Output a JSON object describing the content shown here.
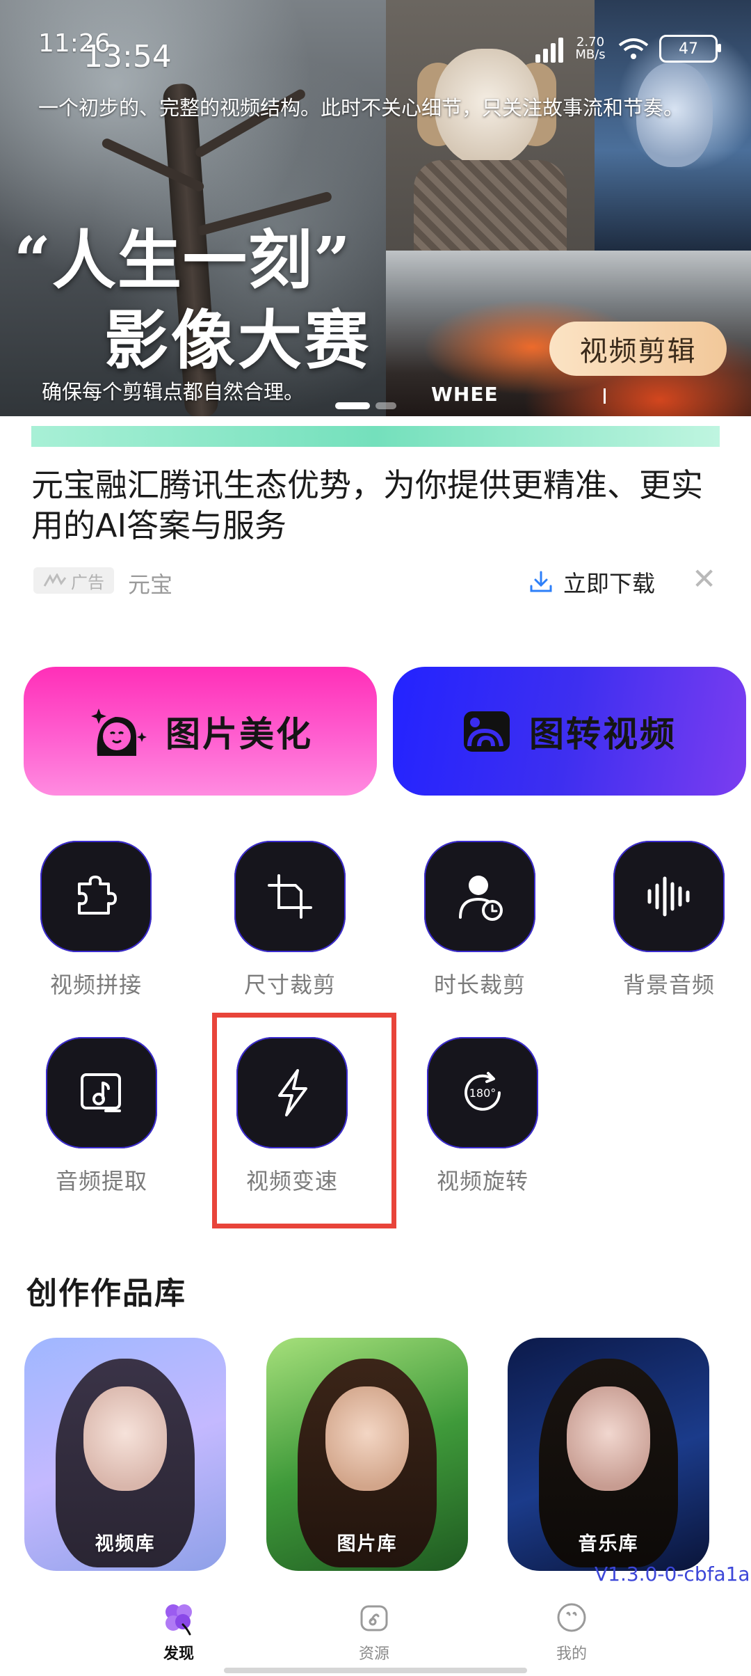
{
  "status": {
    "time_small": "11:26",
    "time": "13:54",
    "net_speed": "2.70 MB/s",
    "battery": "47"
  },
  "banner": {
    "caption_top": "一个初步的、完整的视频结构。此时不关心细节，只关注故事流和节奏。",
    "title_line1": "“人生一刻”",
    "title_line2": "影像大赛",
    "caption_bottom": "确保每个剪辑点都自然合理。",
    "watermark": "WHEE",
    "pill": "视频剪辑"
  },
  "ad": {
    "text": "元宝融汇腾讯生态优势，为你提供更精准、更实用的AI答案与服务",
    "tag": "广告",
    "brand": "元宝",
    "download": "立即下载",
    "close": "✕"
  },
  "actions": {
    "beauty": "图片美化",
    "img2video": "图转视频"
  },
  "tools": [
    {
      "label": "视频拼接",
      "icon": "puzzle-icon"
    },
    {
      "label": "尺寸裁剪",
      "icon": "crop-icon"
    },
    {
      "label": "时长裁剪",
      "icon": "person-clock-icon"
    },
    {
      "label": "背景音频",
      "icon": "sound-wave-icon"
    },
    {
      "label": "音频提取",
      "icon": "music-note-icon"
    },
    {
      "label": "视频变速",
      "icon": "lightning-icon"
    },
    {
      "label": "视频旋转",
      "icon": "rotate-180-icon"
    }
  ],
  "highlight": {
    "color": "#e8443a"
  },
  "library": {
    "title": "创作作品库",
    "cards": [
      {
        "label": "视频库"
      },
      {
        "label": "图片库"
      },
      {
        "label": "音乐库"
      }
    ]
  },
  "version": "V1.3.0-0-cbfa1a",
  "nav": [
    {
      "label": "发现",
      "icon": "discover-icon",
      "active": true
    },
    {
      "label": "资源",
      "icon": "resource-icon",
      "active": false
    },
    {
      "label": "我的",
      "icon": "profile-icon",
      "active": false
    }
  ]
}
